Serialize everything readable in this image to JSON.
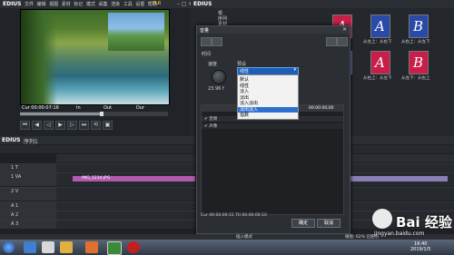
{
  "player": {
    "app_name": "EDIUS",
    "menu": "文件 编辑 视图 素材 标记 模式 采集 渲染 工具 设置 帮助",
    "mode_badge": "PLR",
    "timecode_row": {
      "cur": "Cur 00:00:07:16",
      "in": "In",
      "out": "Out",
      "dur": "Dur"
    },
    "progress_fraction": 0.55,
    "controls": [
      "⏮",
      "◀",
      "◁",
      "▶",
      "▷",
      "⏭",
      "⟲",
      "▣"
    ]
  },
  "bin": {
    "app_name": "EDIUS",
    "tree": [
      "根",
      "序列",
      "素材",
      "特效"
    ],
    "thumbs": [
      {
        "letter": "A",
        "color": "#c81e4a",
        "caption": "从上：从下"
      },
      {
        "letter": "A",
        "color": "#2a4aa8",
        "caption": "从左上：从右下"
      },
      {
        "letter": "B",
        "color": "#2a4aa8",
        "caption": "从右上：从左下"
      },
      {
        "letter": "A",
        "color": "#2a4aa8",
        "caption": "从左：从右"
      },
      {
        "letter": "A",
        "color": "#c81e4a",
        "caption": "从右上：从左下"
      },
      {
        "letter": "B",
        "color": "#c81e4a",
        "caption": "从左下：从右上"
      }
    ]
  },
  "timeline": {
    "app_name": "EDIUS",
    "sequence": "序列1",
    "tracks": [
      {
        "name": "1 T",
        "type": "title"
      },
      {
        "name": "1 VA",
        "type": "video"
      },
      {
        "name": "2 V",
        "type": "video"
      },
      {
        "name": "A 1",
        "type": "audio"
      },
      {
        "name": "A 2",
        "type": "audio"
      },
      {
        "name": "A 3",
        "type": "audio"
      }
    ],
    "clip_label": "IMG_1234.JPG"
  },
  "dialog": {
    "title": "音量",
    "close": "✕",
    "section_time": "时间",
    "duration_label": "速度",
    "duration_value": "23.96 f",
    "preset_label": "预设",
    "preset_selected": "线性",
    "options": [
      "默认",
      "线性",
      "淡入",
      "淡出",
      "淡入淡出",
      "淡出淡入",
      "指数"
    ],
    "selected_index": 5,
    "graph_time": "00:00:00;00",
    "row_labels": [
      "✔ 音频",
      "✔ 声像"
    ],
    "footer": "Cur 00:00:00:15   Ttl 00:00:00:10",
    "ok": "确定",
    "cancel": "取消"
  },
  "statusbar": {
    "left": "插入模式",
    "right": "磁盘: 62% 已使用"
  },
  "taskbar": {
    "time": "16:40",
    "date": "2019/1/5",
    "icons": [
      "explorer",
      "media",
      "folder",
      "firefox",
      "edius",
      "recorder"
    ]
  },
  "watermark": {
    "text": "Bai 经验",
    "url": "jingyan.baidu.com"
  }
}
